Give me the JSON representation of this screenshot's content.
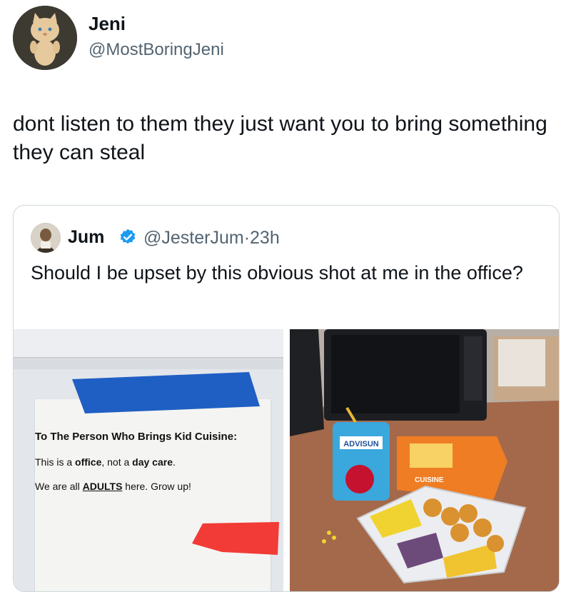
{
  "author": {
    "name": "Jeni",
    "handle": "@MostBoringJeni",
    "text": "dont listen to them they just want you to bring something they can steal"
  },
  "quoted": {
    "name": "Jum",
    "handle": "@JesterJum",
    "separator": "·",
    "time": "23h",
    "text": "Should I be upset by this obvious shot at me in the office?",
    "images": {
      "note": {
        "title": "To The Person Who Brings Kid Cuisine:",
        "line1_pre": "This is a ",
        "line1_b1": "office",
        "line1_mid": ", not a ",
        "line1_b2": "day care",
        "line1_post": ".",
        "line2_pre": "We are all ",
        "line2_u": "ADULTS",
        "line2_post": " here. Grow up!"
      },
      "meal": {
        "pouch_label": "ADVISUN",
        "box_label": "CUISINE"
      }
    }
  },
  "colors": {
    "verified": "#1d9bf0",
    "tape_blue": "#1f5fc4",
    "tape_red": "#f23b36"
  }
}
